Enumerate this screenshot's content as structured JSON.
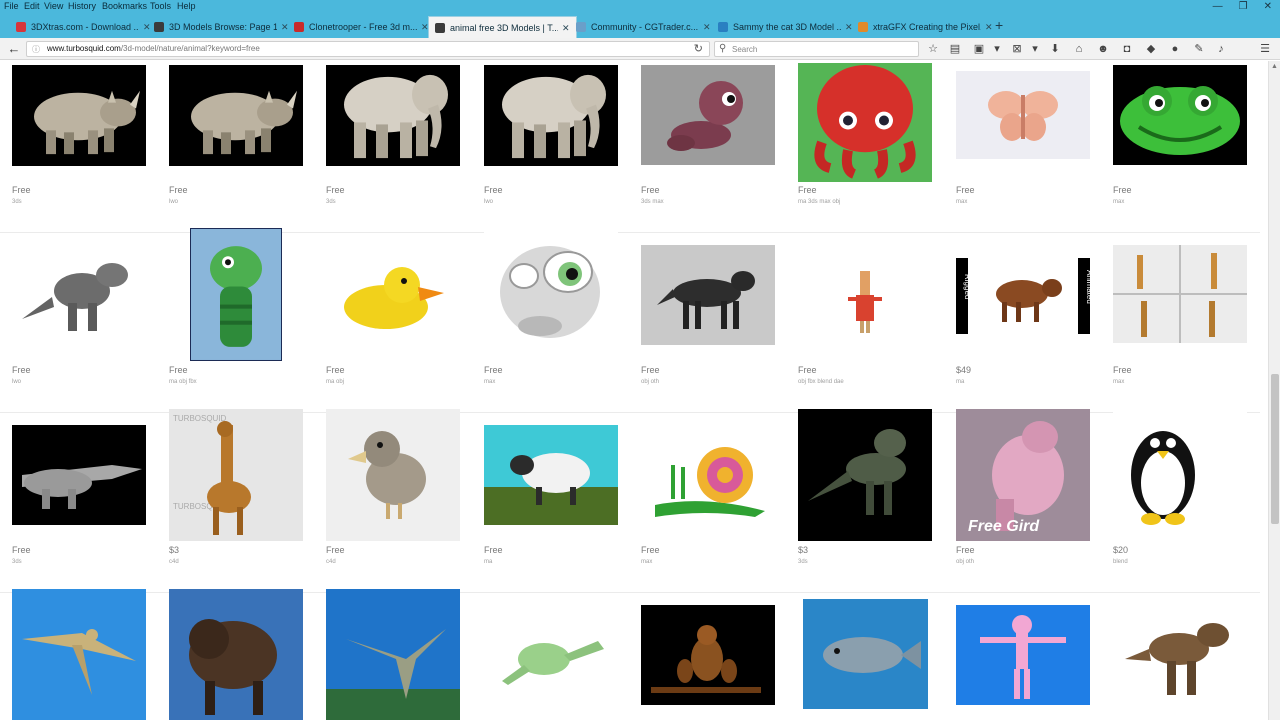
{
  "menu": [
    "File",
    "Edit",
    "View",
    "History",
    "Bookmarks",
    "Tools",
    "Help"
  ],
  "window_controls": {
    "minimize": "—",
    "restore": "❐",
    "close": "✕"
  },
  "tabs": [
    {
      "title": "3DXtras.com - Download ...",
      "fav": "#d7353b"
    },
    {
      "title": "3D Models Browse: Page 1",
      "fav": "#3b3b3b"
    },
    {
      "title": "Clonetrooper - Free 3d m...",
      "fav": "#c92a2a"
    },
    {
      "title": "animal free 3D Models | T...",
      "fav": "#3b3b3b"
    },
    {
      "title": "Community - CGTrader.c...",
      "fav": "#6a9fc9"
    },
    {
      "title": "Sammy the cat 3D Model ...",
      "fav": "#2a7fc1"
    },
    {
      "title": "xtraGFX Creating the Pixel...",
      "fav": "#e08a2a"
    }
  ],
  "new_tab": "+",
  "address": {
    "host": "www.turbosquid.com",
    "path": "/3d-model/nature/animal?keyword=free",
    "info_icon": "ⓘ",
    "reload": "↻"
  },
  "search": {
    "placeholder": "Search"
  },
  "toolbar_icons": [
    {
      "name": "bookmark-star-icon",
      "glyph": "☆"
    },
    {
      "name": "reading-list-icon",
      "glyph": "▤"
    },
    {
      "name": "save-icon",
      "glyph": "▣"
    },
    {
      "name": "dropdown-icon",
      "glyph": "▾"
    },
    {
      "name": "pdf-icon",
      "glyph": "⊠"
    },
    {
      "name": "dropdown-icon",
      "glyph": "▾"
    },
    {
      "name": "download-icon",
      "glyph": "⬇"
    },
    {
      "name": "home-icon",
      "glyph": "⌂"
    },
    {
      "name": "chat-icon",
      "glyph": "☻"
    },
    {
      "name": "pocket-icon",
      "glyph": "◘"
    },
    {
      "name": "shield-icon",
      "glyph": "◆"
    },
    {
      "name": "circle-icon",
      "glyph": "●"
    },
    {
      "name": "extension-icon",
      "glyph": "✎"
    },
    {
      "name": "addon-icon",
      "glyph": "♪"
    },
    {
      "name": "menu-icon",
      "glyph": "☰"
    }
  ],
  "accent_color": "#4bb8dc",
  "models": [
    [
      {
        "subject": "rhino",
        "price": "Free",
        "formats": "3ds"
      },
      {
        "subject": "rhino",
        "price": "Free",
        "formats": "lwo"
      },
      {
        "subject": "elephant",
        "price": "Free",
        "formats": "3ds"
      },
      {
        "subject": "elephant",
        "price": "Free",
        "formats": "lwo"
      },
      {
        "subject": "worm",
        "price": "Free",
        "formats": "3ds max"
      },
      {
        "subject": "octopus",
        "price": "Free",
        "formats": "ma 3ds max obj"
      },
      {
        "subject": "butterfly",
        "price": "Free",
        "formats": "max"
      },
      {
        "subject": "frog face",
        "price": "Free",
        "formats": "max"
      }
    ],
    [
      {
        "subject": "t-rex",
        "price": "Free",
        "formats": "lwo"
      },
      {
        "subject": "dragon",
        "price": "Free",
        "formats": "ma obj fbx"
      },
      {
        "subject": "duck",
        "price": "Free",
        "formats": "ma obj"
      },
      {
        "subject": "cartoon head",
        "price": "Free",
        "formats": "max"
      },
      {
        "subject": "wolf",
        "price": "Free",
        "formats": "obj oth"
      },
      {
        "subject": "rabbit",
        "price": "Free",
        "formats": "obj fbx blend dae"
      },
      {
        "subject": "bull",
        "price": "$49",
        "formats": "ma"
      },
      {
        "subject": "giraffes",
        "price": "Free",
        "formats": "max"
      }
    ],
    [
      {
        "subject": "crocodile",
        "price": "Free",
        "formats": "3ds"
      },
      {
        "subject": "giraffe",
        "price": "$3",
        "formats": "c4d"
      },
      {
        "subject": "bird",
        "price": "Free",
        "formats": "c4d"
      },
      {
        "subject": "sheep",
        "price": "Free",
        "formats": "ma"
      },
      {
        "subject": "snail",
        "price": "Free",
        "formats": "max"
      },
      {
        "subject": "dinosaur",
        "price": "$3",
        "formats": "3ds"
      },
      {
        "subject": "gorilla",
        "price": "Free",
        "formats": "obj oth"
      },
      {
        "subject": "penguin",
        "price": "$20",
        "formats": "blend"
      }
    ],
    [
      {
        "subject": "pterodactyl"
      },
      {
        "subject": "bison"
      },
      {
        "subject": "dinosaur"
      },
      {
        "subject": "frog"
      },
      {
        "subject": "birds"
      },
      {
        "subject": "fish"
      },
      {
        "subject": "pink panther"
      },
      {
        "subject": "t-rex"
      }
    ]
  ],
  "thumb_overlays": {
    "bull_left": "Rigged",
    "bull_right": "Animated",
    "giraffe_watermark": "TURBOSQUID",
    "gorilla_caption": "Free Gird"
  }
}
